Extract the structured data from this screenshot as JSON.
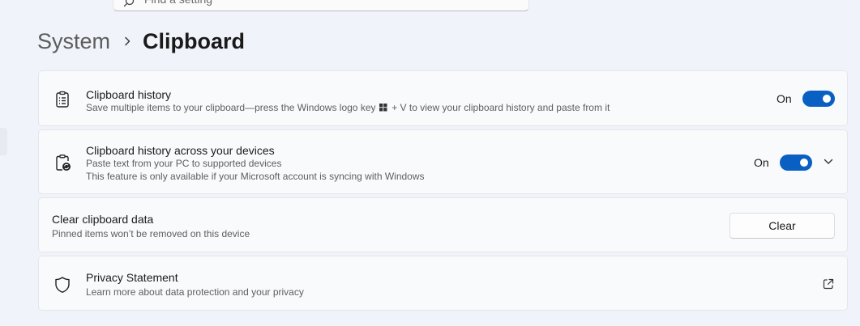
{
  "search": {
    "placeholder": "Find a setting",
    "icon": "search-icon"
  },
  "breadcrumb": {
    "parent": "System",
    "current": "Clipboard"
  },
  "clipboard_history": {
    "icon": "clipboard-list-icon",
    "title": "Clipboard history",
    "desc_before": "Save multiple items to your clipboard—press the Windows logo key",
    "desc_after": "+ V to view your clipboard history and paste from it",
    "state_label": "On",
    "enabled": true
  },
  "clipboard_sync": {
    "icon": "clipboard-sync-icon",
    "title": "Clipboard history across your devices",
    "desc_line1": "Paste text from your PC to supported devices",
    "desc_line2": "This feature is only available if your Microsoft account is syncing with Windows",
    "state_label": "On",
    "enabled": true
  },
  "clear_data": {
    "title": "Clear clipboard data",
    "desc": "Pinned items won’t be removed on this device",
    "button_label": "Clear"
  },
  "privacy": {
    "icon": "shield-icon",
    "title": "Privacy Statement",
    "desc": "Learn more about data protection and your privacy"
  },
  "colors": {
    "accent": "#0a5fc2",
    "background": "#f0f3f9",
    "card": "#f9fafc"
  }
}
